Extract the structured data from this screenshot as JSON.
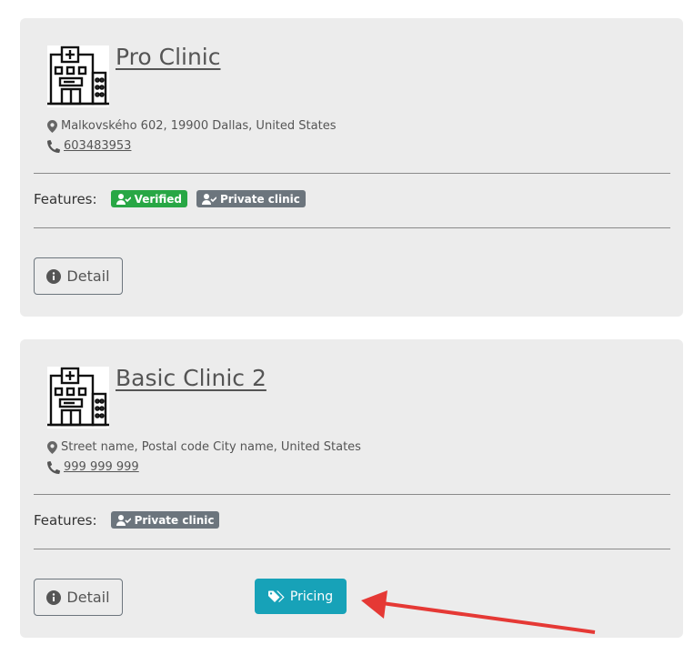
{
  "clinics": [
    {
      "name": "Pro Clinic",
      "address": "Malkovského 602, 19900 Dallas, United States",
      "phone": "603483953",
      "features_label": "Features:",
      "badges": [
        "Verified",
        "Private clinic"
      ],
      "detail_label": "Detail"
    },
    {
      "name": "Basic Clinic 2",
      "address": "Street name, Postal code City name, United States",
      "phone": "999 999 999",
      "features_label": "Features:",
      "badges": [
        "Private clinic"
      ],
      "detail_label": "Detail",
      "pricing_label": "Pricing"
    }
  ],
  "colors": {
    "card_bg": "#ececec",
    "verified_badge": "#28a745",
    "private_badge": "#6c757d",
    "pricing_button": "#17a2b8",
    "annotation_arrow": "#e53935"
  },
  "icons": [
    "hospital-building-icon",
    "map-marker-icon",
    "phone-icon",
    "user-check-icon",
    "info-circle-icon",
    "tags-icon",
    "red-arrow-annotation"
  ]
}
